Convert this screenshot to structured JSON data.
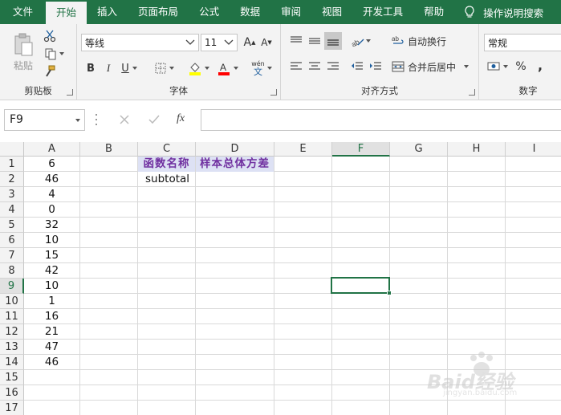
{
  "ribbon_tabs": [
    "文件",
    "开始",
    "插入",
    "页面布局",
    "公式",
    "数据",
    "审阅",
    "视图",
    "开发工具",
    "帮助"
  ],
  "active_tab": "开始",
  "tell_me": "操作说明搜索",
  "clipboard": {
    "paste_label": "粘贴",
    "group_label": "剪贴板"
  },
  "font": {
    "name": "等线",
    "size": "11",
    "bold": "B",
    "italic": "I",
    "underline": "U",
    "phonetic": "wén",
    "phonetic_char": "文",
    "group_label": "字体",
    "fill_color": "#ffff00",
    "font_color": "#ff0000"
  },
  "alignment": {
    "wrap_text": "自动换行",
    "merge_center": "合并后居中",
    "group_label": "对齐方式"
  },
  "number": {
    "format": "常规",
    "percent": "%",
    "comma": ",",
    "group_label": "数字"
  },
  "name_box": "F9",
  "formula_bar": {
    "fx": "fx",
    "content": ""
  },
  "columns": [
    "A",
    "B",
    "C",
    "D",
    "E",
    "F",
    "G",
    "H",
    "I"
  ],
  "selected_column": "F",
  "rows": [
    "1",
    "2",
    "3",
    "4",
    "5",
    "6",
    "7",
    "8",
    "9",
    "10",
    "11",
    "12",
    "13",
    "14",
    "15",
    "16",
    "17"
  ],
  "selected_row": "9",
  "column_a_values": [
    "6",
    "46",
    "4",
    "0",
    "32",
    "10",
    "15",
    "42",
    "10",
    "1",
    "16",
    "21",
    "47",
    "46"
  ],
  "c1": "函数名称",
  "d1": "样本总体方差",
  "c2": "subtotal",
  "watermark": {
    "text": "Baid经验",
    "sub": "jingyan.baidu.com"
  },
  "colors": {
    "excel_green": "#217346",
    "header_fill": "#dde1f4",
    "header_text": "#7030a0"
  }
}
